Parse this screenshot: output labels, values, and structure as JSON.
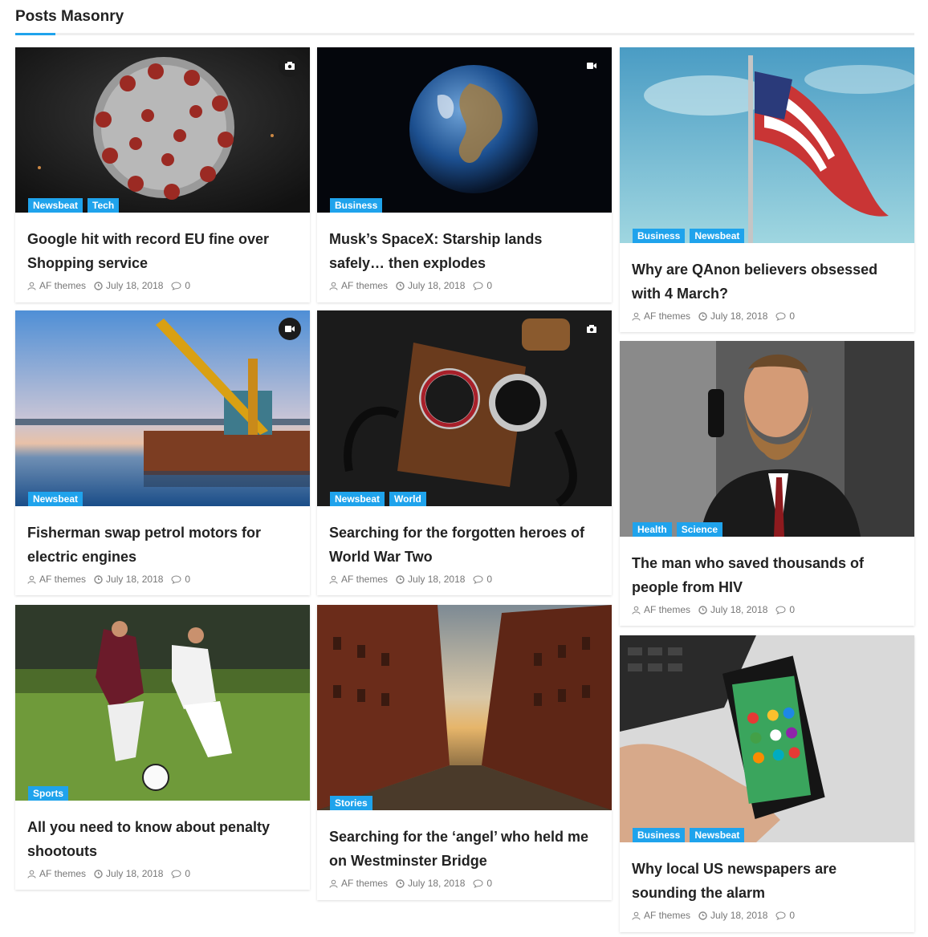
{
  "section": {
    "title": "Posts Masonry"
  },
  "colors": {
    "accent": "#1fa3ec",
    "title": "#222222",
    "meta": "#777777"
  },
  "posts": [
    {
      "title": "Google hit with record EU fine over Shopping service",
      "categories": [
        "Newsbeat",
        "Tech"
      ],
      "author": "AF themes",
      "date": "July 18, 2018",
      "comments": "0",
      "media_icon": "camera-icon",
      "image": "coronavirus"
    },
    {
      "title": "Fisherman swap petrol motors for electric engines",
      "categories": [
        "Newsbeat"
      ],
      "author": "AF themes",
      "date": "July 18, 2018",
      "comments": "0",
      "media_icon": "video-icon",
      "image": "crane-barge"
    },
    {
      "title": "All you need to know about penalty shootouts",
      "categories": [
        "Sports"
      ],
      "author": "AF themes",
      "date": "July 18, 2018",
      "comments": "0",
      "media_icon": "",
      "image": "soccer"
    },
    {
      "title": "Musk’s SpaceX: Starship lands safely… then explodes",
      "categories": [
        "Business"
      ],
      "author": "AF themes",
      "date": "July 18, 2018",
      "comments": "0",
      "media_icon": "video-icon",
      "image": "earth"
    },
    {
      "title": "Searching for the forgotten heroes of World War Two",
      "categories": [
        "Newsbeat",
        "World"
      ],
      "author": "AF themes",
      "date": "July 18, 2018",
      "comments": "0",
      "media_icon": "camera-icon",
      "image": "watches"
    },
    {
      "title": "Searching for the ‘angel’ who held me on Westminster Bridge",
      "categories": [
        "Stories"
      ],
      "author": "AF themes",
      "date": "July 18, 2018",
      "comments": "0",
      "media_icon": "",
      "image": "canal"
    },
    {
      "title": "Why are QAnon believers obsessed with 4 March?",
      "categories": [
        "Business",
        "Newsbeat"
      ],
      "author": "AF themes",
      "date": "July 18, 2018",
      "comments": "0",
      "media_icon": "",
      "image": "us-flag"
    },
    {
      "title": "The man who saved thousands of people from HIV",
      "categories": [
        "Health",
        "Science"
      ],
      "author": "AF themes",
      "date": "July 18, 2018",
      "comments": "0",
      "media_icon": "",
      "image": "bearded-man"
    },
    {
      "title": "Why local US newspapers are sounding the alarm",
      "categories": [
        "Business",
        "Newsbeat"
      ],
      "author": "AF themes",
      "date": "July 18, 2018",
      "comments": "0",
      "media_icon": "",
      "image": "smartphone"
    }
  ]
}
